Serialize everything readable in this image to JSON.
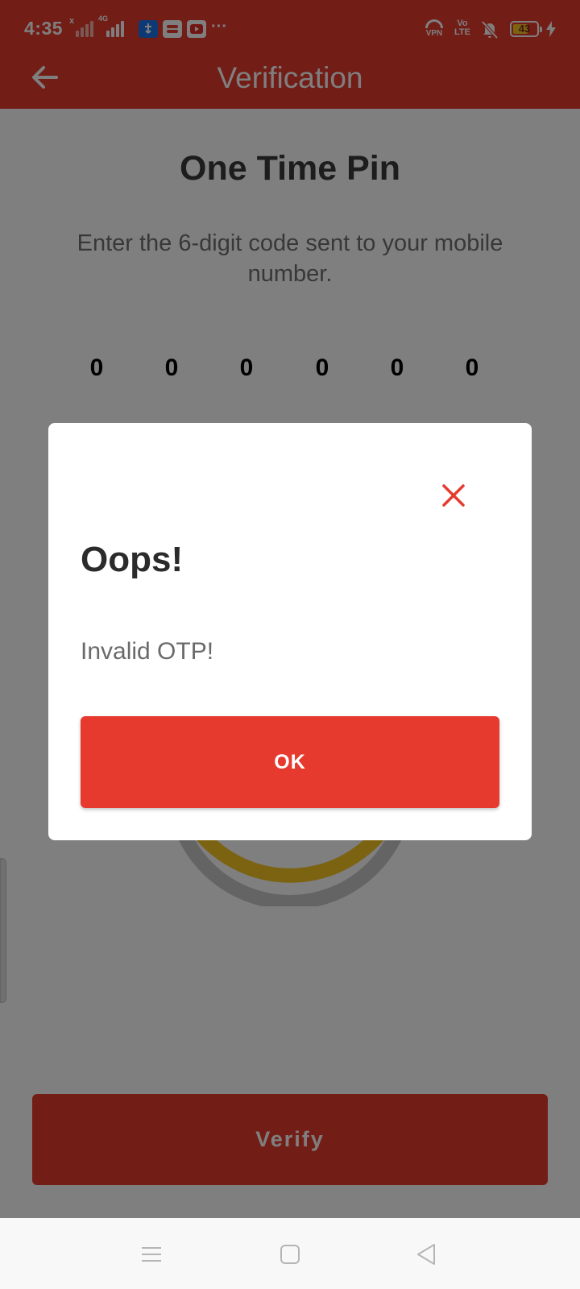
{
  "status_bar": {
    "time": "4:35",
    "network_1": "x",
    "network_2": "4G",
    "vpn_label": "VPN",
    "volte_label": "Vo LTE",
    "battery_level": "43",
    "icons": [
      "usb-debug-icon",
      "app-notification-icon",
      "youtube-icon",
      "more-dots-icon",
      "vpn-icon",
      "volte-icon",
      "mute-bell-icon",
      "battery-icon",
      "charging-icon"
    ]
  },
  "app_bar": {
    "back_icon": "back-arrow-icon",
    "title": "Verification"
  },
  "screen": {
    "title": "One Time Pin",
    "subtitle": "Enter the 6-digit code sent to your mobile number.",
    "digits": [
      "0",
      "0",
      "0",
      "0",
      "0",
      "0"
    ],
    "verify_label": "Verify"
  },
  "dialog": {
    "close_icon": "close-icon",
    "title": "Oops!",
    "message": "Invalid OTP!",
    "ok_label": "OK"
  },
  "nav_bar": {
    "icons": [
      "menu-icon",
      "home-square-icon",
      "back-triangle-icon"
    ]
  },
  "colors": {
    "brand_red": "#e63a2e",
    "timer_ring": "#f6c624",
    "scrim": "rgba(0,0,0,0.5)"
  }
}
